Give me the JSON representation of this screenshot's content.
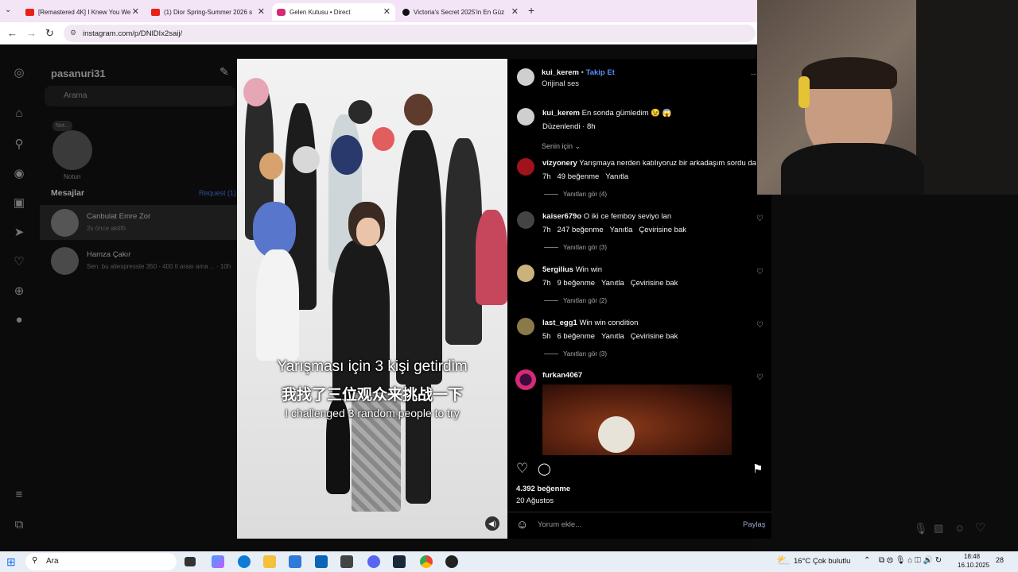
{
  "browser": {
    "tabs": [
      {
        "title": "[Remastered 4K] I Knew You We",
        "fav_color": "#e62117"
      },
      {
        "title": "(1) Dior Spring-Summer 2026 s",
        "fav_color": "#e62117"
      },
      {
        "title": "Gelen Kutusu • Direct",
        "fav_color": "#d62976"
      },
      {
        "title": "Victoria's Secret 2025'in En Güz",
        "fav_color": "#111111"
      }
    ],
    "new_tab": "+",
    "url": "instagram.com/p/DNlDIx2saij/"
  },
  "instagram": {
    "username": "pasanuri31",
    "search_placeholder": "Arama",
    "note_label": "Not...",
    "note_caption": "Notun",
    "messages_title": "Mesajlar",
    "requests_label": "Request (1)",
    "conversations": [
      {
        "name": "Canbulat Emre Zor",
        "preview": "2s önce aktifti",
        "time": ""
      },
      {
        "name": "Hamza Çakır",
        "preview": "Sen: bu aliexpresste 350 - 400 tl arası ama ...",
        "time": "· 10h"
      }
    ]
  },
  "post": {
    "author": "kui_kerem",
    "follow": "Takip Et",
    "audio": "Orijinal ses",
    "more": "···",
    "caption_user": "kui_kerem",
    "caption_text": "En sonda gümledim 😉 😱",
    "caption_meta": "Düzenlendi · 8h",
    "sort_label": "Senin için ⌄",
    "subtitles": {
      "turkish": "Yarışması için 3 kişi getirdim",
      "chinese": "我找了三位观众来挑战一下",
      "english": "I challenged 3 random people to try"
    },
    "comments": [
      {
        "user": "vizyonery",
        "text": "Yarışmaya nerden katılıyoruz bir arkadaşım sordu da",
        "time": "7h",
        "likes": "49 beğenme",
        "reply": "Yanıtla",
        "translate": "",
        "replies": "Yanıtları gör (4)"
      },
      {
        "user": "kaiser679o",
        "text": "O iki ce femboy seviyo lan",
        "time": "7h",
        "likes": "247 beğenme",
        "reply": "Yanıtla",
        "translate": "Çevirisine bak",
        "replies": "Yanıtları gör (3)"
      },
      {
        "user": "5ergilius",
        "text": "Win win",
        "time": "7h",
        "likes": "9 beğenme",
        "reply": "Yanıtla",
        "translate": "Çevirisine bak",
        "replies": "Yanıtları gör (2)"
      },
      {
        "user": "last_egg1",
        "text": "Win win condition",
        "time": "5h",
        "likes": "6 beğenme",
        "reply": "Yanıtla",
        "translate": "Çevirisine bak",
        "replies": "Yanıtları gör (3)"
      },
      {
        "user": "furkan4067",
        "text": "",
        "time": "",
        "likes": "",
        "reply": "",
        "translate": "",
        "replies": ""
      }
    ],
    "likes": "4.392 beğenme",
    "date": "20 Ağustos",
    "comment_placeholder": "Yorum ekle...",
    "share": "Paylaş"
  },
  "taskbar": {
    "search": "Ara",
    "weather": "16°C  Çok bulutlu",
    "time": "18:48",
    "date": "16.10.2025",
    "notifications": "28"
  }
}
